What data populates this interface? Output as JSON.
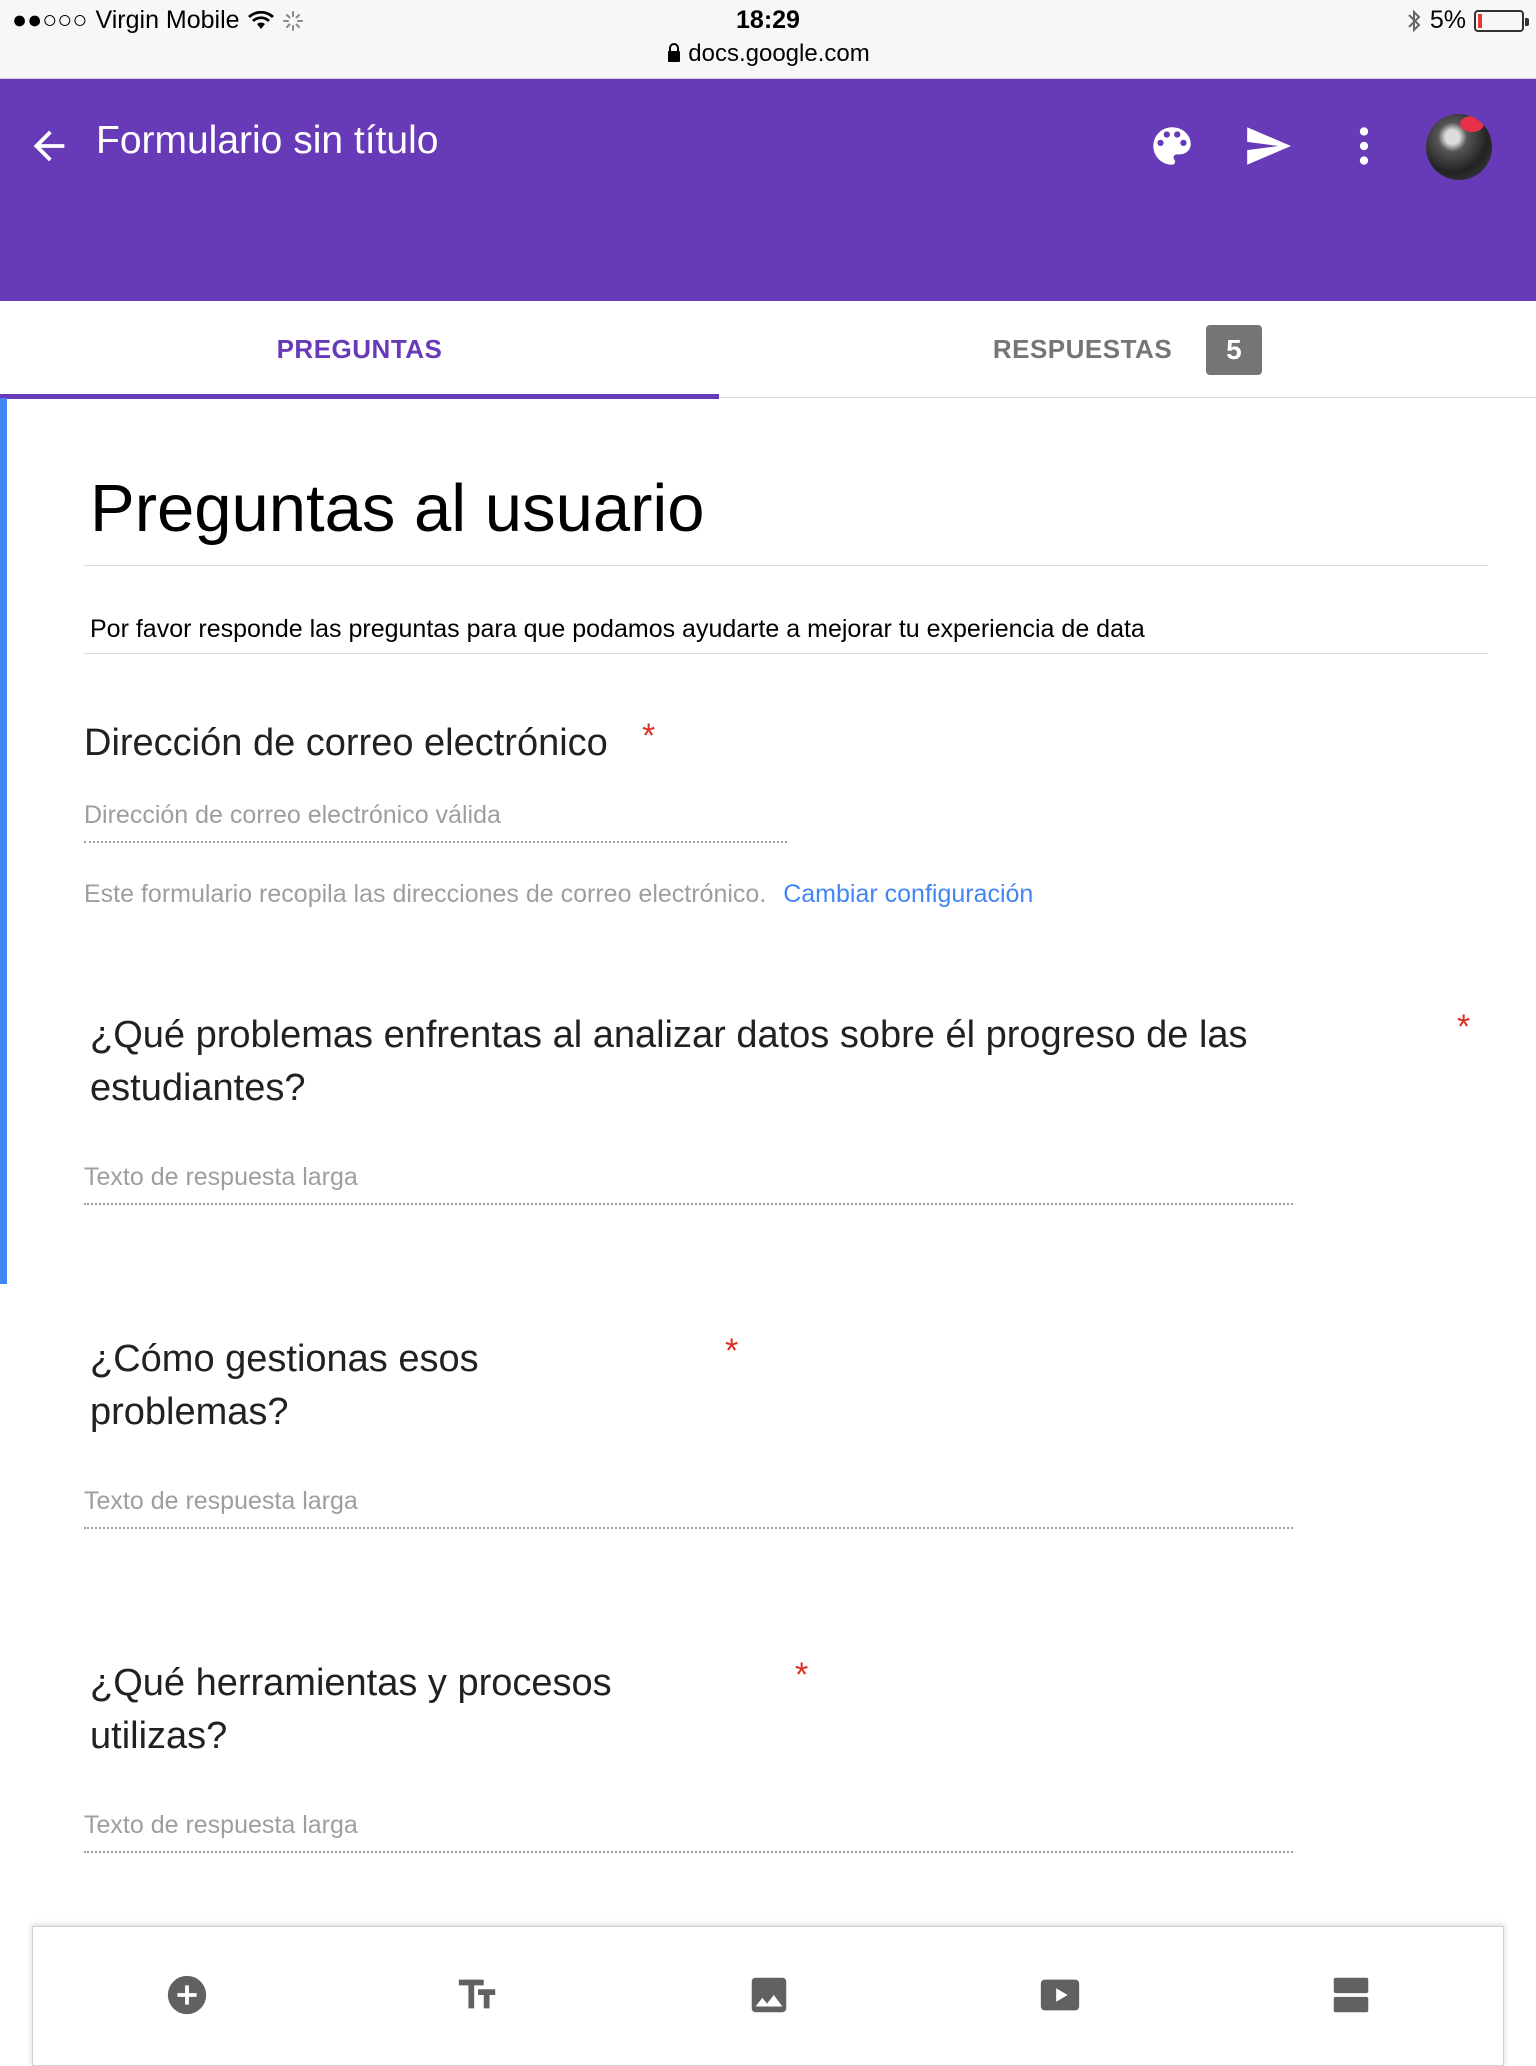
{
  "status_bar": {
    "signal": "●●○○○",
    "carrier": "Virgin Mobile",
    "time": "18:29",
    "url": "docs.google.com",
    "battery": "5%"
  },
  "app_bar": {
    "title": "Formulario sin título",
    "color": "#673ab7",
    "icons": [
      "back-arrow-icon",
      "palette-icon",
      "send-icon",
      "more-vert-icon"
    ]
  },
  "tabs": {
    "questions": "PREGUNTAS",
    "responses": "RESPUESTAS",
    "responses_count": "5"
  },
  "form": {
    "title": "Preguntas al usuario",
    "description": "Por favor responde las preguntas para que podamos ayudarte a mejorar tu experiencia de data",
    "email": {
      "label": "Dirección de correo electrónico",
      "required_mark": "*",
      "placeholder": "Dirección de correo electrónico válida",
      "note": "Este formulario recopila las direcciones de correo electrónico.",
      "change_link": "Cambiar configuración"
    },
    "questions": [
      {
        "title_line1": "¿Qué problemas enfrentas al analizar datos sobre él progreso de las",
        "title_line2": "estudiantes?",
        "required_mark": "*",
        "answer_hint": "Texto de respuesta larga"
      },
      {
        "title_line1": "¿Cómo gestionas esos",
        "title_line2": "problemas?",
        "required_mark": "*",
        "answer_hint": "Texto de respuesta larga"
      },
      {
        "title_line1": "¿Qué herramientas y procesos",
        "title_line2": "utilizas?",
        "required_mark": "*",
        "answer_hint": "Texto de respuesta larga"
      }
    ]
  },
  "toolbar": {
    "icons": [
      "add-question-icon",
      "add-title-icon",
      "add-image-icon",
      "add-video-icon",
      "add-section-icon"
    ]
  },
  "colors": {
    "accent": "#673ab7",
    "focus": "#4285f4",
    "required": "#d93025",
    "link": "#4285f4"
  }
}
